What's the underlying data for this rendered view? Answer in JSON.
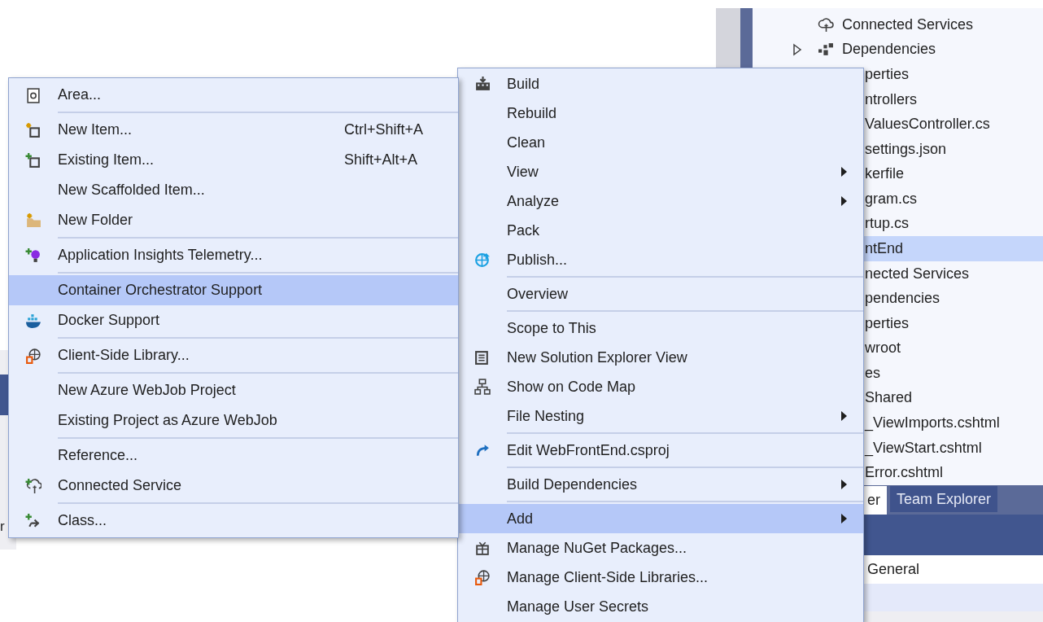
{
  "background_fragment": {
    "text": "r"
  },
  "solution_explorer": {
    "rows": [
      {
        "label": "Connected Services",
        "selected": false
      },
      {
        "label": "Dependencies",
        "selected": false,
        "expanded": false
      },
      {
        "label": "perties",
        "selected": false
      },
      {
        "label": "ntrollers",
        "selected": false
      },
      {
        "label": "ValuesController.cs",
        "selected": false
      },
      {
        "label": "settings.json",
        "selected": false
      },
      {
        "label": "kerfile",
        "selected": false
      },
      {
        "label": "gram.cs",
        "selected": false
      },
      {
        "label": "rtup.cs",
        "selected": false
      },
      {
        "label": "ntEnd",
        "selected": true
      },
      {
        "label": "nected Services",
        "selected": false
      },
      {
        "label": "pendencies",
        "selected": false
      },
      {
        "label": "perties",
        "selected": false
      },
      {
        "label": "wroot",
        "selected": false
      },
      {
        "label": "es",
        "selected": false
      },
      {
        "label": "Shared",
        "selected": false
      },
      {
        "label": "_ViewImports.cshtml",
        "selected": false
      },
      {
        "label": "_ViewStart.cshtml",
        "selected": false
      },
      {
        "label": "Error.cshtml",
        "selected": false
      }
    ],
    "tabs": [
      {
        "label": "er",
        "selected": true
      },
      {
        "label": "Team Explorer",
        "selected": false
      }
    ],
    "properties_row": "General"
  },
  "context_menu": {
    "items": [
      {
        "kind": "item",
        "label": "Build",
        "has_submenu": false,
        "selected": false
      },
      {
        "kind": "item",
        "label": "Rebuild",
        "has_submenu": false,
        "selected": false
      },
      {
        "kind": "item",
        "label": "Clean",
        "has_submenu": false,
        "selected": false
      },
      {
        "kind": "item",
        "label": "View",
        "has_submenu": true,
        "selected": false
      },
      {
        "kind": "item",
        "label": "Analyze",
        "has_submenu": true,
        "selected": false
      },
      {
        "kind": "item",
        "label": "Pack",
        "has_submenu": false,
        "selected": false
      },
      {
        "kind": "item",
        "label": "Publish...",
        "has_submenu": false,
        "selected": false
      },
      {
        "kind": "separator"
      },
      {
        "kind": "item",
        "label": "Overview",
        "has_submenu": false,
        "selected": false
      },
      {
        "kind": "separator"
      },
      {
        "kind": "item",
        "label": "Scope to This",
        "has_submenu": false,
        "selected": false
      },
      {
        "kind": "item",
        "label": "New Solution Explorer View",
        "has_submenu": false,
        "selected": false
      },
      {
        "kind": "item",
        "label": "Show on Code Map",
        "has_submenu": false,
        "selected": false
      },
      {
        "kind": "item",
        "label": "File Nesting",
        "has_submenu": true,
        "selected": false
      },
      {
        "kind": "separator"
      },
      {
        "kind": "item",
        "label": "Edit WebFrontEnd.csproj",
        "has_submenu": false,
        "selected": false
      },
      {
        "kind": "separator"
      },
      {
        "kind": "item",
        "label": "Build Dependencies",
        "has_submenu": true,
        "selected": false
      },
      {
        "kind": "separator"
      },
      {
        "kind": "item",
        "label": "Add",
        "has_submenu": true,
        "selected": true
      },
      {
        "kind": "item",
        "label": "Manage NuGet Packages...",
        "has_submenu": false,
        "selected": false
      },
      {
        "kind": "item",
        "label": "Manage Client-Side Libraries...",
        "has_submenu": false,
        "selected": false
      },
      {
        "kind": "item",
        "label": "Manage User Secrets",
        "has_submenu": false,
        "selected": false
      }
    ]
  },
  "add_submenu": {
    "items": [
      {
        "kind": "item",
        "label": "Area...",
        "selected": false
      },
      {
        "kind": "separator"
      },
      {
        "kind": "item",
        "label": "New Item...",
        "shortcut": "Ctrl+Shift+A",
        "selected": false
      },
      {
        "kind": "item",
        "label": "Existing Item...",
        "shortcut": "Shift+Alt+A",
        "selected": false
      },
      {
        "kind": "item",
        "label": "New Scaffolded Item...",
        "selected": false
      },
      {
        "kind": "item",
        "label": "New Folder",
        "selected": false
      },
      {
        "kind": "separator"
      },
      {
        "kind": "item",
        "label": "Application Insights Telemetry...",
        "selected": false
      },
      {
        "kind": "separator"
      },
      {
        "kind": "item",
        "label": "Container Orchestrator Support",
        "selected": true
      },
      {
        "kind": "item",
        "label": "Docker Support",
        "selected": false
      },
      {
        "kind": "separator"
      },
      {
        "kind": "item",
        "label": "Client-Side Library...",
        "selected": false
      },
      {
        "kind": "separator"
      },
      {
        "kind": "item",
        "label": "New Azure WebJob Project",
        "selected": false
      },
      {
        "kind": "item",
        "label": "Existing Project as Azure WebJob",
        "selected": false
      },
      {
        "kind": "separator"
      },
      {
        "kind": "item",
        "label": "Reference...",
        "selected": false
      },
      {
        "kind": "item",
        "label": "Connected Service",
        "selected": false
      },
      {
        "kind": "separator"
      },
      {
        "kind": "item",
        "label": "Class...",
        "selected": false
      }
    ]
  }
}
